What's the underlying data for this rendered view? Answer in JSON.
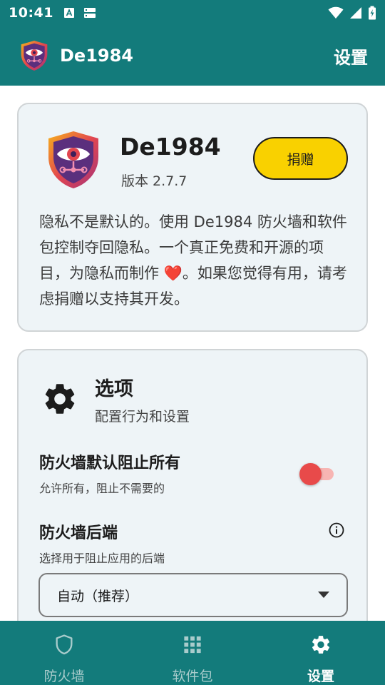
{
  "status_bar": {
    "time": "10:41"
  },
  "app_bar": {
    "title": "De1984",
    "action": "设置"
  },
  "about": {
    "name": "De1984",
    "version": "版本 2.7.7",
    "donate_label": "捐赠",
    "description_part1": "隐私不是默认的。使用 De1984 防火墙和软件包控制夺回隐私。一个真正免费和开源的项目，为隐私而制作 ",
    "heart": "❤️",
    "description_part2": "。如果您觉得有用，请考虑捐赠以支持其开发。"
  },
  "options": {
    "title": "选项",
    "subtitle": "配置行为和设置",
    "block_all": {
      "title": "防火墙默认阻止所有",
      "subtitle": "允许所有，阻止不需要的",
      "enabled": false
    },
    "backend": {
      "title": "防火墙后端",
      "subtitle": "选择用于阻止应用的后端",
      "selected": "自动（推荐）"
    }
  },
  "bottom_nav": [
    {
      "label": "防火墙",
      "icon": "shield-icon",
      "active": false
    },
    {
      "label": "软件包",
      "icon": "grid-icon",
      "active": false
    },
    {
      "label": "设置",
      "icon": "gear-icon",
      "active": true
    }
  ],
  "colors": {
    "primary": "#137b7b",
    "donate": "#f9d100",
    "toggle_thumb": "#e84a4a",
    "card_bg": "#eef4f7"
  }
}
